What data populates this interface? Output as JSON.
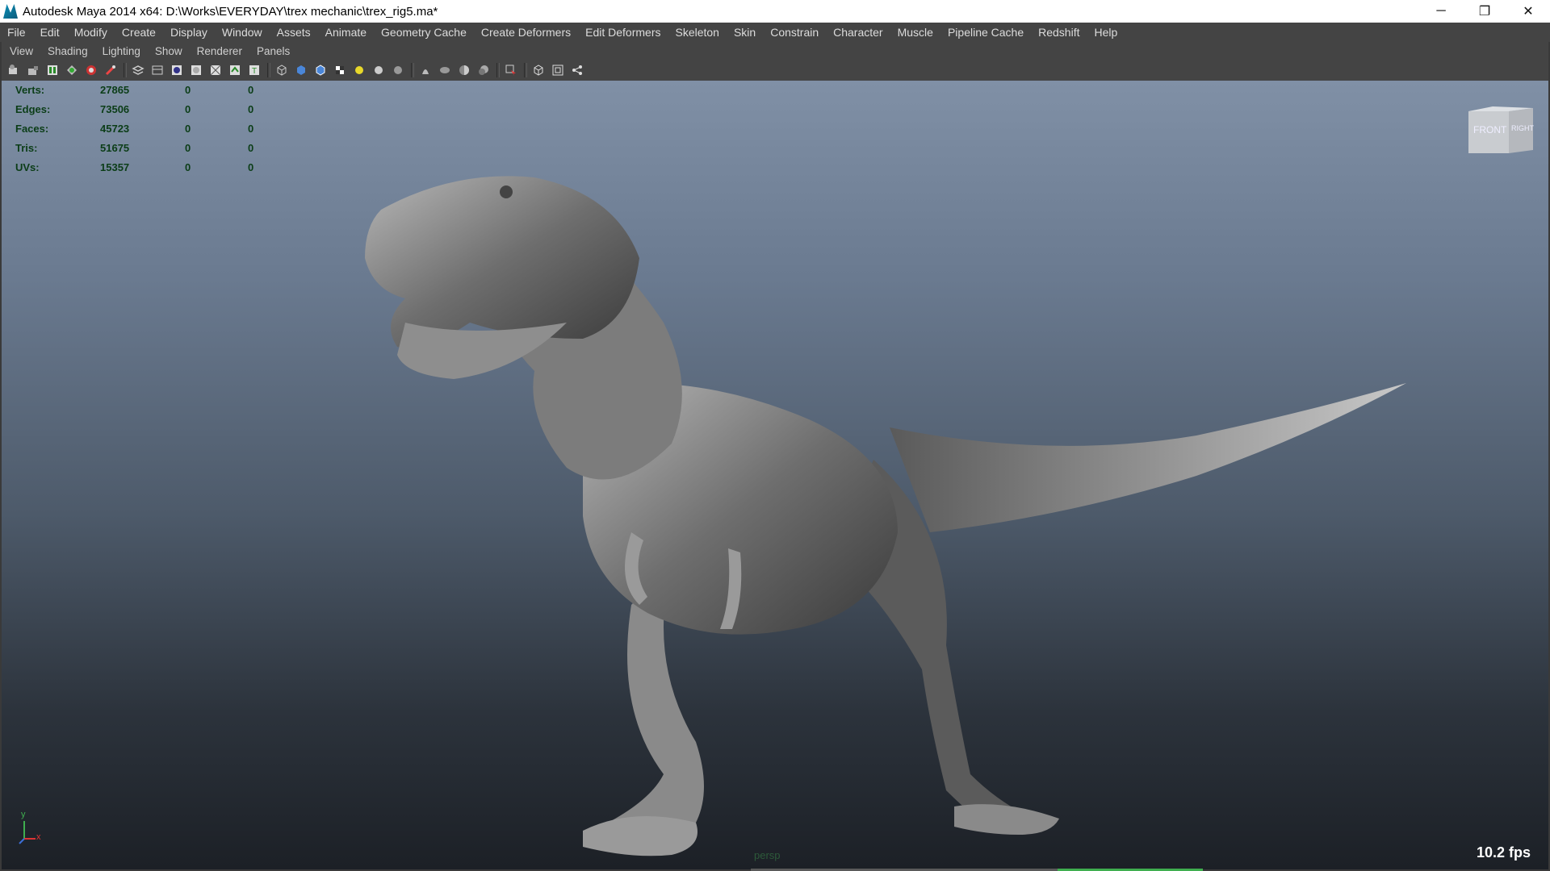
{
  "window": {
    "title": "Autodesk Maya 2014 x64: D:\\Works\\EVERYDAY\\trex mechanic\\trex_rig5.ma*",
    "controls": {
      "minimize": "─",
      "restore": "❐",
      "close": "✕"
    }
  },
  "menubar": {
    "items": [
      "File",
      "Edit",
      "Modify",
      "Create",
      "Display",
      "Window",
      "Assets",
      "Animate",
      "Geometry Cache",
      "Create Deformers",
      "Edit Deformers",
      "Skeleton",
      "Skin",
      "Constrain",
      "Character",
      "Muscle",
      "Pipeline Cache",
      "Redshift",
      "Help"
    ]
  },
  "panel_menu": {
    "items": [
      "View",
      "Shading",
      "Lighting",
      "Show",
      "Renderer",
      "Panels"
    ]
  },
  "toolbar": {
    "icons": [
      "select-camera-icon",
      "lock-camera-icon",
      "camera-attributes-icon",
      "bookmarks-icon",
      "image-plane-icon",
      "grid-icon",
      "film-gate-icon",
      "resolution-gate-icon",
      "gate-mask-icon",
      "field-chart-icon",
      "safe-action-icon",
      "safe-title-icon",
      "wireframe-icon",
      "smooth-shade-icon",
      "shaded-wireframe-icon",
      "textured-icon",
      "use-all-lights-icon",
      "shadows-icon",
      "xray-icon",
      "xray-joints-icon",
      "backface-culling-icon",
      "smooth-preview-icon",
      "isolate-select-icon",
      "high-quality-icon",
      "ao-icon",
      "motion-blur-icon",
      "camera-selection-icon"
    ]
  },
  "hud": {
    "rows": [
      {
        "label": "Verts:",
        "total": "27865",
        "selected": "0",
        "comp": "0"
      },
      {
        "label": "Edges:",
        "total": "73506",
        "selected": "0",
        "comp": "0"
      },
      {
        "label": "Faces:",
        "total": "45723",
        "selected": "0",
        "comp": "0"
      },
      {
        "label": "Tris:",
        "total": "51675",
        "selected": "0",
        "comp": "0"
      },
      {
        "label": "UVs:",
        "total": "15357",
        "selected": "0",
        "comp": "0"
      }
    ]
  },
  "viewcube": {
    "front": "FRONT",
    "right": "RIGHT"
  },
  "viewport": {
    "camera": "persp",
    "fps": "10.2 fps",
    "axis": {
      "y": "y",
      "x": "x"
    },
    "model": "t-rex-model"
  }
}
